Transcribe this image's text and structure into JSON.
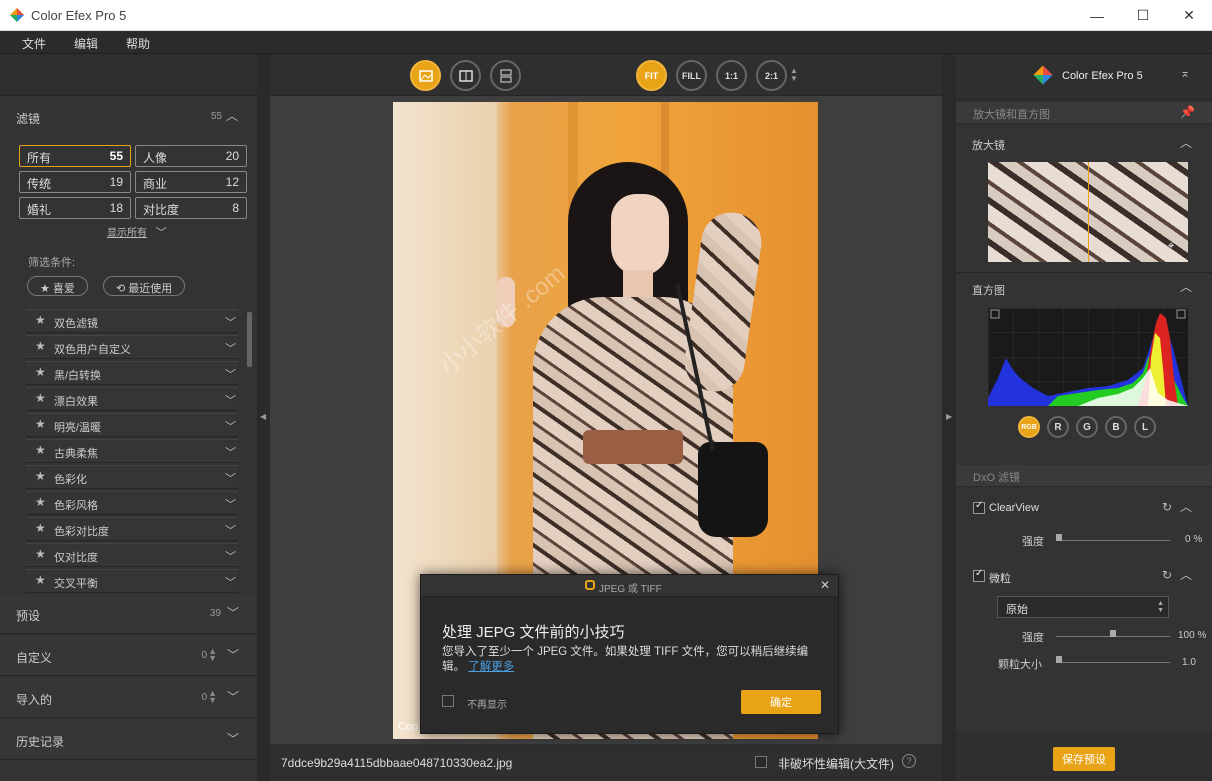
{
  "app": {
    "title": "Color Efex Pro 5",
    "win_minimize": "—",
    "win_maximize": "☐",
    "win_close": "✕"
  },
  "menu": [
    "文件",
    "编辑",
    "帮助"
  ],
  "left": {
    "filters_label": "滤镜",
    "filters_count": "55",
    "categories": [
      {
        "name": "所有",
        "count": "55"
      },
      {
        "name": "人像",
        "count": "20"
      },
      {
        "name": "传统",
        "count": "19"
      },
      {
        "name": "商业",
        "count": "12"
      },
      {
        "name": "婚礼",
        "count": "18"
      },
      {
        "name": "对比度",
        "count": "8"
      }
    ],
    "show_all": "显示所有",
    "filter_conditions": "筛选条件:",
    "favorites": "★ 喜爱",
    "recent": "最近使用",
    "filter_list": [
      "双色滤镜",
      "双色用户自定义",
      "黑/白转换",
      "漂白效果",
      "明亮/温暖",
      "古典柔焦",
      "色彩化",
      "色彩风格",
      "色彩对比度",
      "仅对比度",
      "交叉平衡"
    ],
    "presets_label": "预设",
    "presets_count": "39",
    "custom_label": "自定义",
    "custom_count": "0",
    "imported_label": "导入的",
    "imported_count": "0",
    "history_label": "历史记录"
  },
  "toolbar": {
    "fit": "FIT",
    "fill": "FILL",
    "one": "1:1",
    "two": "2:1"
  },
  "bottom": {
    "filename": "7ddce9b29a4115dbbaae048710330ea2.jpg",
    "nondestructive": "非破坏性编辑(大文件)",
    "help": "?"
  },
  "photo": {
    "copyright": "Cop"
  },
  "watermark": "小小软件 .com",
  "dialog": {
    "header": "JPEG 或 TIFF",
    "close": "✕",
    "title": "处理 JEPG 文件前的小技巧",
    "body": "您导入了至少一个 JPEG 文件。如果处理 TIFF 文件，您可以稍后继续编辑。",
    "link": "了解更多",
    "dont_show": "不再显示",
    "ok": "确定"
  },
  "right": {
    "brand": "Color Efex Pro 5",
    "loupe_histo": "放大镜和直方图",
    "loupe": "放大镜",
    "histogram": "直方图",
    "channels": [
      "RGB",
      "R",
      "G",
      "B",
      "L"
    ],
    "dxo_filters": "DxO 滤镜",
    "clearview": {
      "name": "ClearView",
      "strength_label": "强度",
      "strength_value": "0 %",
      "strength": 0
    },
    "grain": {
      "name": "微粒",
      "preset": "原始",
      "strength_label": "强度",
      "strength_value": "100 %",
      "strength": 0.5,
      "size_label": "颗粒大小",
      "size_value": "1.0",
      "size": 0
    },
    "save_preset": "保存预设"
  }
}
